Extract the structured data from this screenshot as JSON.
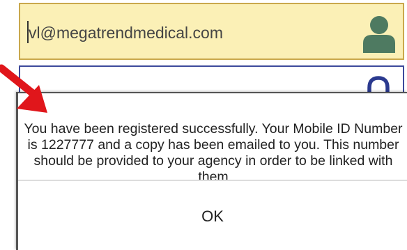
{
  "login_form": {
    "email_value": "vl@megatrendmedical.com"
  },
  "dialog": {
    "message": "You have been registered successfully. Your Mobile ID Number is 1227777 and a copy has been emailed to you. This number should be provided to your agency in order to be linked with them",
    "ok_label": "OK"
  },
  "colors": {
    "email_field_bg": "#fbf0b6",
    "email_field_border": "#c9a84c",
    "password_field_border": "#3d4a9b",
    "icon_color": "#4e7a61",
    "lock_icon_color": "#2b3a8f",
    "annotation_arrow": "#e0161b"
  },
  "icons": {
    "email_field": "user-icon",
    "password_field": "lock-icon",
    "annotation": "red-arrow"
  }
}
